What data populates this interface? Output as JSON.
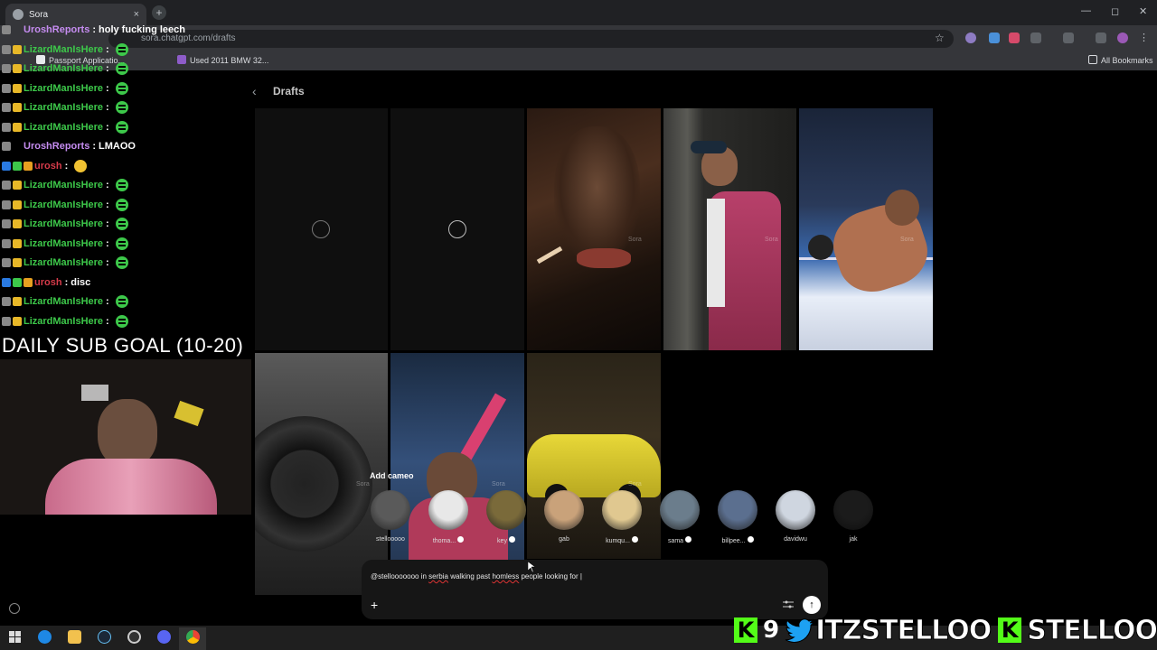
{
  "browser": {
    "tab_title": "Sora",
    "tab_close": "×",
    "new_tab": "+",
    "url": "sora.chatgpt.com/drafts",
    "star": "☆",
    "min": "—",
    "max": "◻",
    "close": "✕",
    "bookmarks": [
      "Passport Applicatio...",
      "Used 2011 BMW 32..."
    ],
    "all_bookmarks": "All Bookmarks"
  },
  "page": {
    "back_glyph": "‹",
    "title": "Drafts",
    "watermark": "Sora"
  },
  "chat": [
    {
      "user": "UroshReports",
      "msg": "holy fucking leech",
      "emote": false
    },
    {
      "user": "LizardManIsHere",
      "msg": "",
      "emote": true
    },
    {
      "user": "LizardManIsHere",
      "msg": "",
      "emote": true
    },
    {
      "user": "LizardManIsHere",
      "msg": "",
      "emote": true
    },
    {
      "user": "LizardManIsHere",
      "msg": "",
      "emote": true
    },
    {
      "user": "LizardManIsHere",
      "msg": "",
      "emote": true
    },
    {
      "user": "UroshReports",
      "msg": "LMAOO",
      "emote": false
    },
    {
      "user": "urosh",
      "msg": "",
      "emote": false
    },
    {
      "user": "LizardManIsHere",
      "msg": "",
      "emote": true
    },
    {
      "user": "LizardManIsHere",
      "msg": "",
      "emote": true
    },
    {
      "user": "LizardManIsHere",
      "msg": "",
      "emote": true
    },
    {
      "user": "LizardManIsHere",
      "msg": "",
      "emote": true
    },
    {
      "user": "LizardManIsHere",
      "msg": "",
      "emote": true
    },
    {
      "user": "urosh",
      "msg": "disc",
      "emote": false
    },
    {
      "user": "LizardManIsHere",
      "msg": "",
      "emote": true
    },
    {
      "user": "LizardManIsHere",
      "msg": "",
      "emote": true
    }
  ],
  "overlay": {
    "sub_goal": "DAILY SUB GOAL (10-20)",
    "kick_count": "9",
    "twitter_handle": "ITZSTELLOO",
    "kick_handle": "STELLOOO"
  },
  "cameo": {
    "label": "Add cameo",
    "people": [
      {
        "name": "stellooooo",
        "verified": false,
        "color": "#5a5a5a"
      },
      {
        "name": "thoma...",
        "verified": true,
        "color": "#e8e8e8"
      },
      {
        "name": "key",
        "verified": true,
        "color": "#7a6a3a"
      },
      {
        "name": "gab",
        "verified": false,
        "color": "#c9a27a"
      },
      {
        "name": "kumqu...",
        "verified": true,
        "color": "#e0c890"
      },
      {
        "name": "sama",
        "verified": true,
        "color": "#6b7d8c"
      },
      {
        "name": "billpee...",
        "verified": true,
        "color": "#5b6f8f"
      },
      {
        "name": "davidwu",
        "verified": false,
        "color": "#cfd6e0"
      },
      {
        "name": "jak",
        "verified": false,
        "color": "#444"
      }
    ]
  },
  "composer": {
    "prefix": "@stellooooooo in ",
    "w1": "serbia",
    "mid": " walking past ",
    "w2": "homless",
    "suffix": " people looking for |",
    "plus": "+",
    "send": "↑"
  }
}
